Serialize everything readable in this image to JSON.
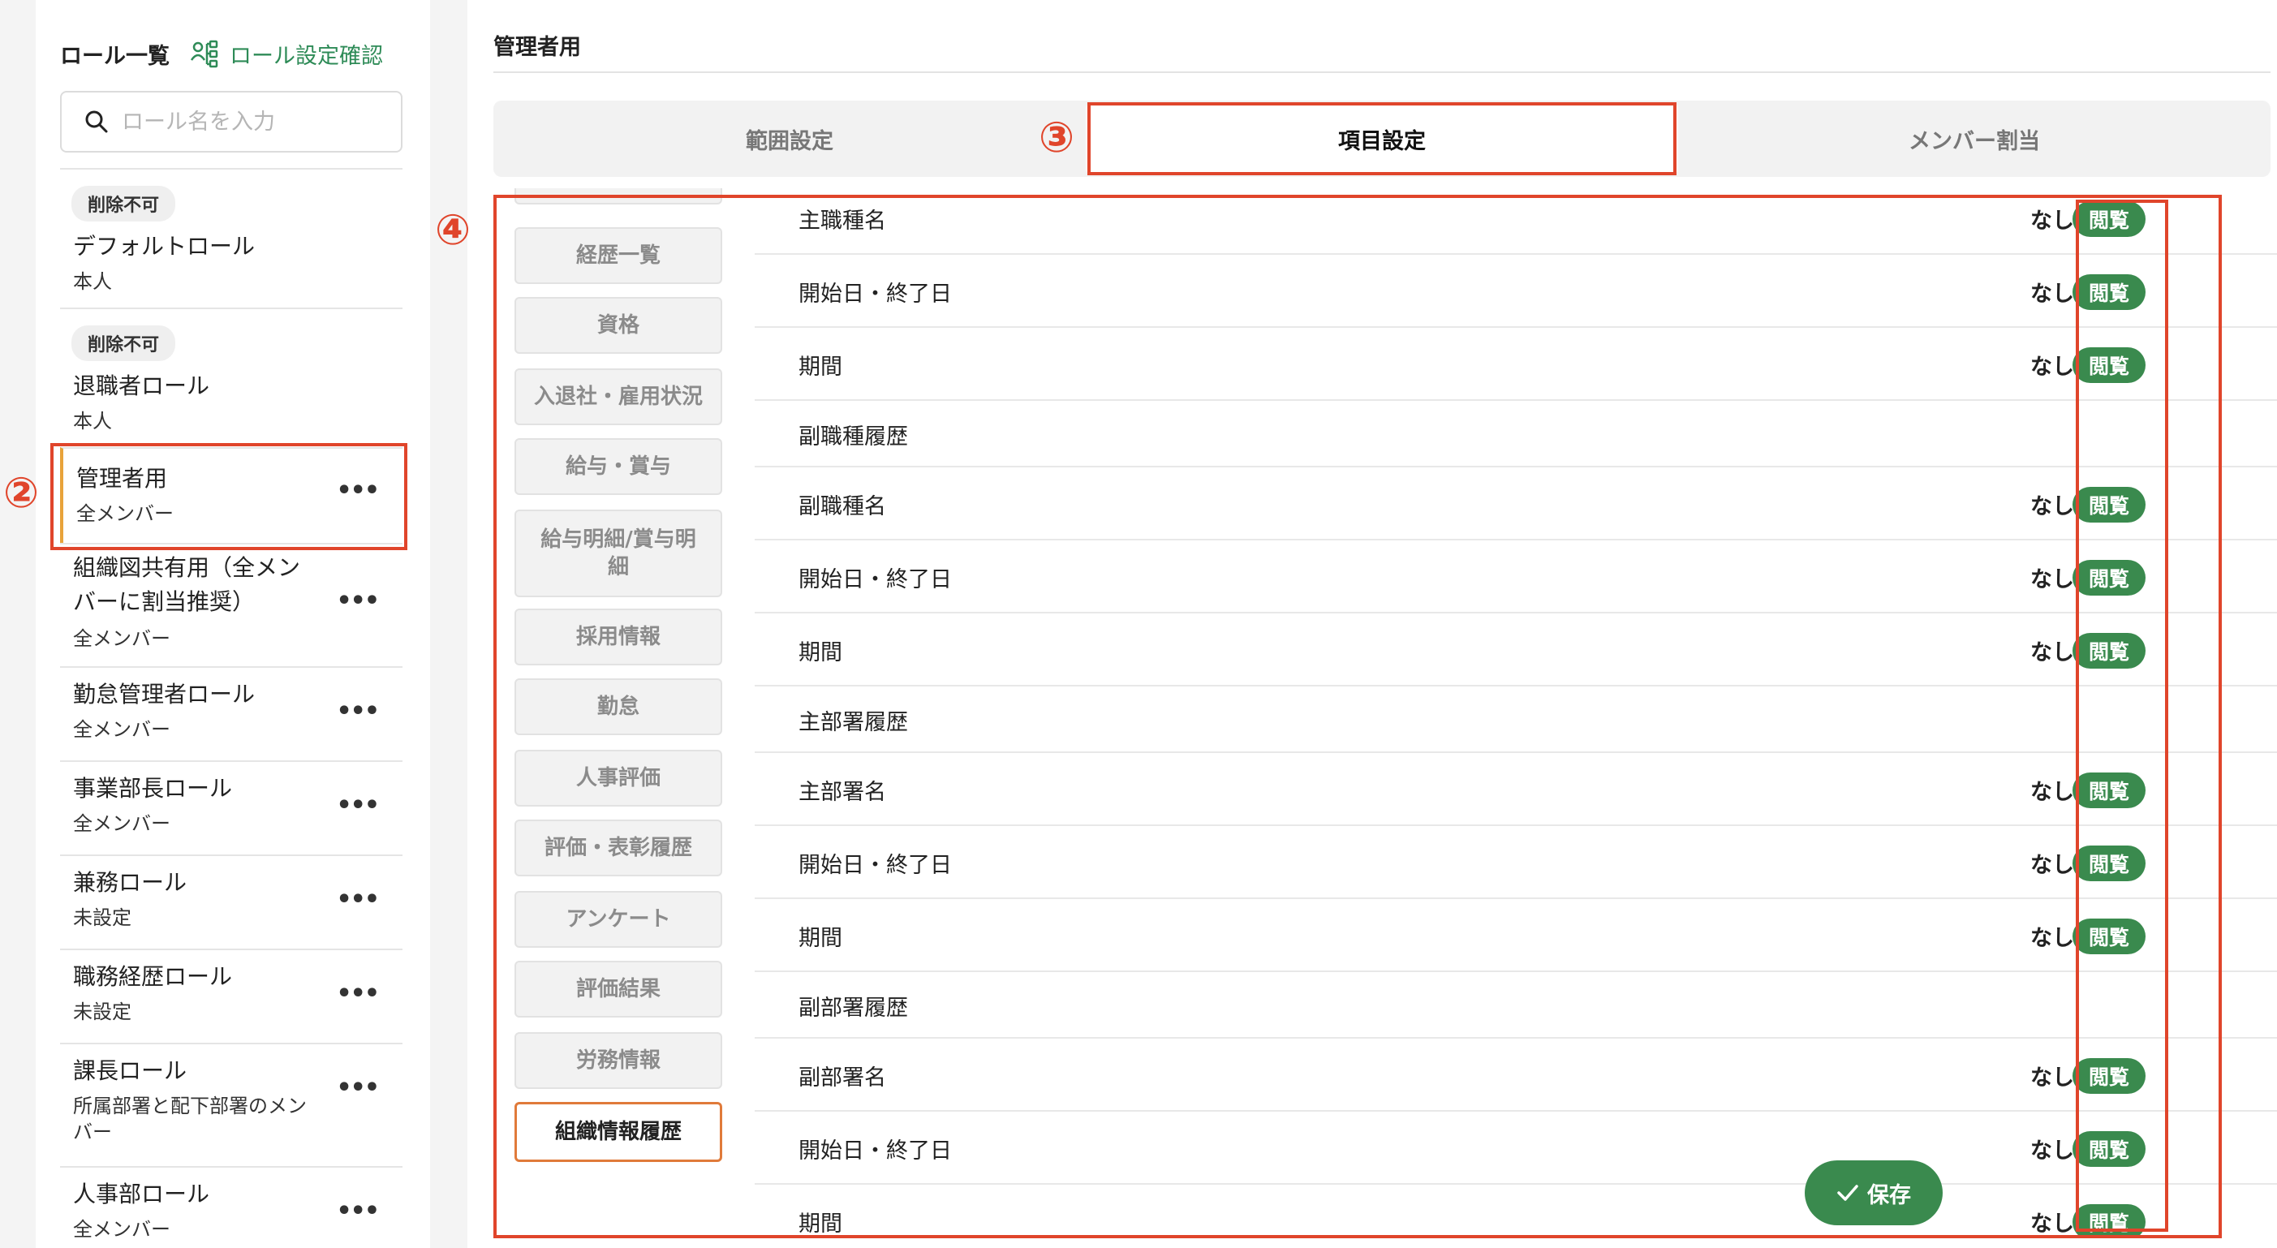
{
  "left_panel": {
    "title": "ロール一覧",
    "role_settings_link": "ロール設定確認",
    "search_placeholder": "ロール名を入力",
    "roles": [
      {
        "badge": "削除不可",
        "name": "デフォルトロール",
        "scope": "本人"
      },
      {
        "badge": "削除不可",
        "name": "退職者ロール",
        "scope": "本人"
      },
      {
        "name": "管理者用",
        "scope": "全メンバー",
        "more": "•••"
      },
      {
        "name": "組織図共有用（全メンバーに割当推奨）",
        "scope": "全メンバー",
        "more": "•••"
      },
      {
        "name": "勤怠管理者ロール",
        "scope": "全メンバー",
        "more": "•••"
      },
      {
        "name": "事業部長ロール",
        "scope": "全メンバー",
        "more": "•••"
      },
      {
        "name": "兼務ロール",
        "scope": "未設定",
        "more": "•••"
      },
      {
        "name": "職務経歴ロール",
        "scope": "未設定",
        "more": "•••"
      },
      {
        "name": "課長ロール",
        "scope": "所属部署と配下部署のメンバー",
        "more": "•••"
      },
      {
        "name": "人事部ロール",
        "scope": "全メンバー",
        "more": "•••"
      }
    ]
  },
  "main": {
    "page_title": "管理者用",
    "tabs": [
      "範囲設定",
      "項目設定",
      "メンバー割当"
    ],
    "categories": [
      "経歴一覧",
      "資格",
      "入退社・雇用状況",
      "給与・賞与",
      "給与明細/賞与明細",
      "採用情報",
      "勤怠",
      "人事評価",
      "評価・表彰履歴",
      "アンケート",
      "評価結果",
      "労務情報",
      "組織情報履歴"
    ],
    "fields": [
      {
        "label": "主職種名",
        "none": "なし",
        "view": "閲覧"
      },
      {
        "label": "開始日・終了日",
        "none": "なし",
        "view": "閲覧"
      },
      {
        "label": "期間",
        "none": "なし",
        "view": "閲覧"
      },
      {
        "label": "副職種履歴"
      },
      {
        "label": "副職種名",
        "none": "なし",
        "view": "閲覧"
      },
      {
        "label": "開始日・終了日",
        "none": "なし",
        "view": "閲覧"
      },
      {
        "label": "期間",
        "none": "なし",
        "view": "閲覧"
      },
      {
        "label": "主部署履歴"
      },
      {
        "label": "主部署名",
        "none": "なし",
        "view": "閲覧"
      },
      {
        "label": "開始日・終了日",
        "none": "なし",
        "view": "閲覧"
      },
      {
        "label": "期間",
        "none": "なし",
        "view": "閲覧"
      },
      {
        "label": "副部署履歴"
      },
      {
        "label": "副部署名",
        "none": "なし",
        "view": "閲覧"
      },
      {
        "label": "開始日・終了日",
        "none": "なし",
        "view": "閲覧"
      },
      {
        "label": "期間",
        "none": "なし",
        "view": "閲覧"
      }
    ],
    "save_label": "保存"
  },
  "annotations": [
    "②",
    "③",
    "④"
  ],
  "colors": {
    "accent_green": "#3a8a4e",
    "annotation_red": "#e0452b",
    "selected_orange": "#e07a3a"
  }
}
